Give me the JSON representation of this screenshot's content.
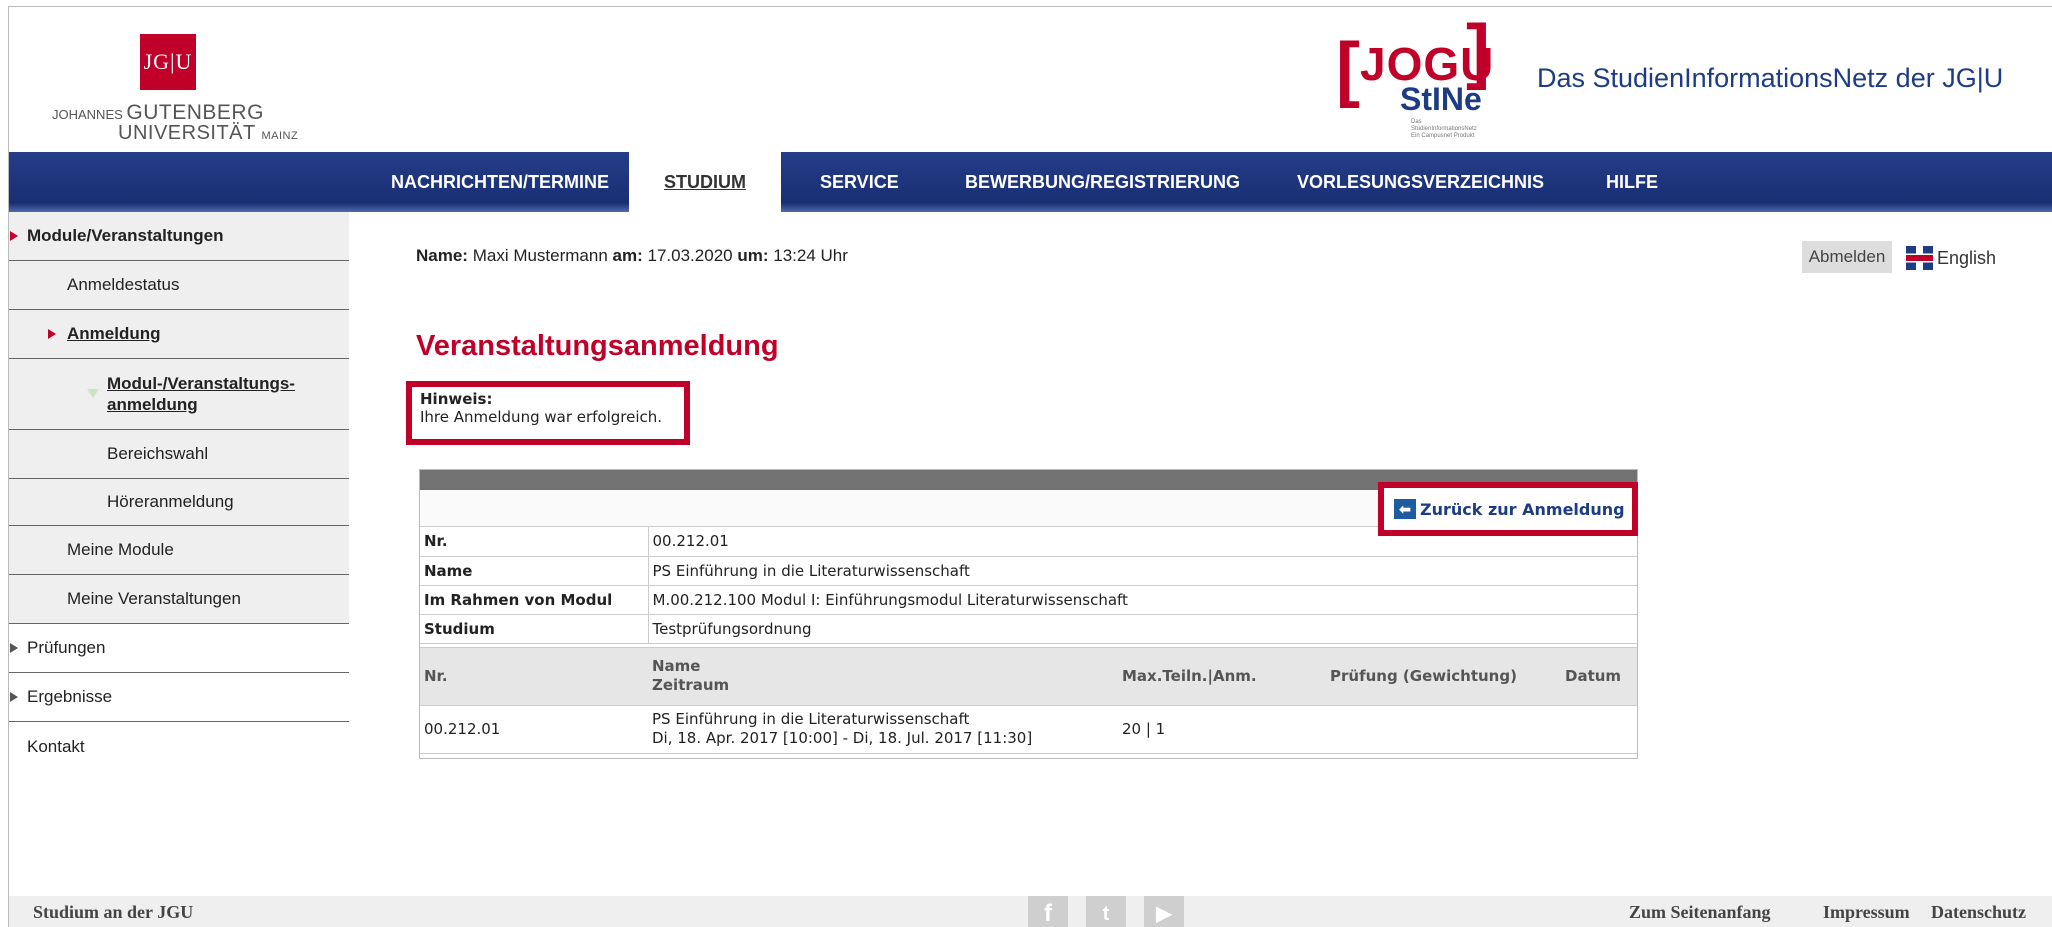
{
  "header": {
    "uni_mark": "JG|U",
    "uni_name_line1_small": "JOHANNES",
    "uni_name_line1_big": "GUTENBERG",
    "uni_name_line2": "UNIVERSITÄT",
    "uni_name_line2_small": "MAINZ",
    "jogu": "JOGU",
    "stine": "StINe",
    "stine_tagline": "Das StudienInformationsNetz Ein Campusnet Produkt",
    "site_title": "Das StudienInformationsNetz der JG|U"
  },
  "nav": {
    "items": [
      {
        "label": "NACHRICHTEN/TERMINE"
      },
      {
        "label": "STUDIUM"
      },
      {
        "label": "SERVICE"
      },
      {
        "label": "BEWERBUNG/REGISTRIERUNG"
      },
      {
        "label": "VORLESUNGSVERZEICHNIS"
      },
      {
        "label": "HILFE"
      }
    ]
  },
  "sidebar": {
    "items": [
      {
        "label": "Module/Veranstaltungen"
      },
      {
        "label": "Anmeldestatus"
      },
      {
        "label": "Anmeldung"
      },
      {
        "label_line1": "Modul-/Veranstaltungs-",
        "label_line2": "anmeldung"
      },
      {
        "label": "Bereichswahl"
      },
      {
        "label": "Höreranmeldung"
      },
      {
        "label": "Meine Module"
      },
      {
        "label": "Meine Veranstaltungen"
      },
      {
        "label": "Prüfungen"
      },
      {
        "label": "Ergebnisse"
      },
      {
        "label": "Kontakt"
      }
    ]
  },
  "userline": {
    "name_label": "Name:",
    "name": "Maxi Mustermann",
    "date_label": "am:",
    "date": "17.03.2020",
    "time_label": "um:",
    "time": "13:24 Uhr"
  },
  "logout_label": "Abmelden",
  "language_label": "English",
  "page_title": "Veranstaltungsanmeldung",
  "hint": {
    "title": "Hinweis:",
    "text": "Ihre Anmeldung war erfolgreich."
  },
  "back_label": "Zurück zur Anmeldung",
  "info": [
    {
      "key": "Nr.",
      "value": "00.212.01"
    },
    {
      "key": "Name",
      "value": "PS Einführung in die Literaturwissenschaft"
    },
    {
      "key": "Im Rahmen von Modul",
      "value": "M.00.212.100 Modul I: Einführungsmodul Literaturwissenschaft"
    },
    {
      "key": "Studium",
      "value": "Testprüfungsordnung"
    }
  ],
  "table": {
    "headers": {
      "nr": "Nr.",
      "name": "Name",
      "zeitraum": "Zeitraum",
      "max": "Max.Teiln.|Anm.",
      "pruefung": "Prüfung (Gewichtung)",
      "datum": "Datum"
    },
    "rows": [
      {
        "nr": "00.212.01",
        "name": "PS Einführung in die Literaturwissenschaft",
        "zeitraum": "Di, 18. Apr. 2017 [10:00] - Di, 18. Jul. 2017 [11:30]",
        "max": "20 | 1",
        "pruefung": "",
        "datum": ""
      }
    ]
  },
  "footer": {
    "left": "Studium an der JGU",
    "social": [
      "f",
      "t",
      "▶"
    ],
    "links": [
      "Zum Seitenanfang",
      "Impressum",
      "Datenschutz"
    ]
  },
  "colors": {
    "brand_red": "#c1002a",
    "brand_blue": "#1d3c84"
  }
}
